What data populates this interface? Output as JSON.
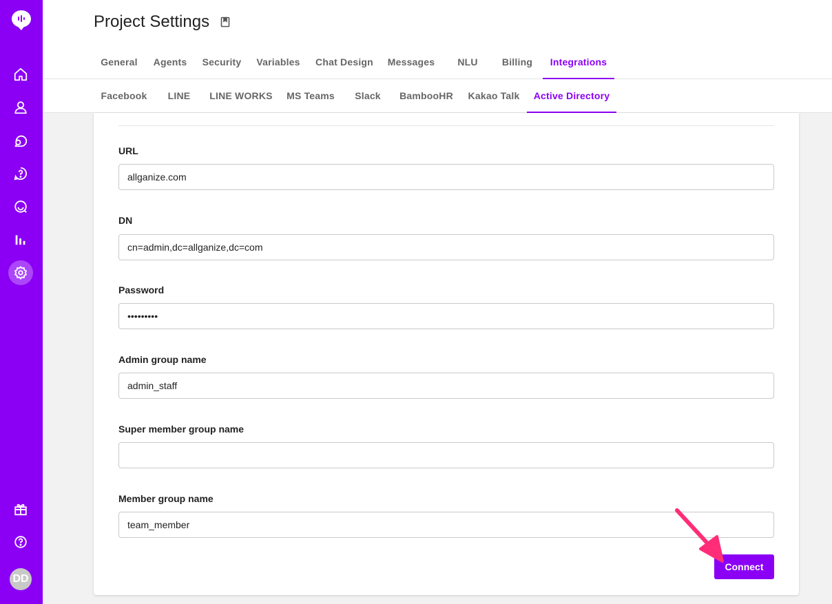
{
  "header": {
    "title": "Project Settings",
    "bookmark_icon": "bookmark-icon"
  },
  "tabs": [
    {
      "label": "General"
    },
    {
      "label": "Agents"
    },
    {
      "label": "Security"
    },
    {
      "label": "Variables"
    },
    {
      "label": "Chat Design"
    },
    {
      "label": "Messages"
    },
    {
      "label": "NLU"
    },
    {
      "label": "Billing"
    },
    {
      "label": "Integrations",
      "active": true
    }
  ],
  "subtabs": [
    {
      "label": "Facebook"
    },
    {
      "label": "LINE"
    },
    {
      "label": "LINE WORKS"
    },
    {
      "label": "MS Teams"
    },
    {
      "label": "Slack"
    },
    {
      "label": "BambooHR"
    },
    {
      "label": "Kakao Talk"
    },
    {
      "label": "Active Directory",
      "active": true
    }
  ],
  "sidebar": {
    "icons": [
      "logo-icon",
      "home-icon",
      "user-icon",
      "chat-icon",
      "faq-icon",
      "search-chat-icon",
      "analytics-icon",
      "settings-icon",
      "gift-icon",
      "help-icon"
    ],
    "avatar_initials": "DD"
  },
  "form": {
    "url_label": "URL",
    "url_value": "allganize.com",
    "dn_label": "DN",
    "dn_value": "cn=admin,dc=allganize,dc=com",
    "password_label": "Password",
    "password_value": "pass12345",
    "admin_group_label": "Admin group name",
    "admin_group_value": "admin_staff",
    "super_member_group_label": "Super member group name",
    "super_member_group_value": "",
    "member_group_label": "Member group name",
    "member_group_value": "team_member",
    "connect_label": "Connect"
  },
  "colors": {
    "accent": "#8b00f5",
    "annotation_arrow": "#ff2d78"
  }
}
